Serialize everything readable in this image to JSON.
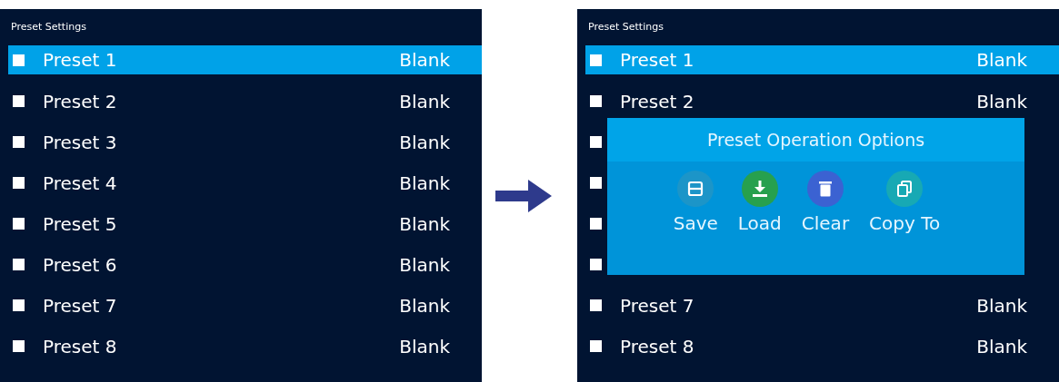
{
  "panels": [
    {
      "title": "Preset Settings",
      "rows": [
        {
          "label": "Preset 1",
          "value": "Blank",
          "selected": true,
          "checked": false
        },
        {
          "label": "Preset 2",
          "value": "Blank",
          "selected": false,
          "checked": false
        },
        {
          "label": "Preset 3",
          "value": "Blank",
          "selected": false,
          "checked": false
        },
        {
          "label": "Preset 4",
          "value": "Blank",
          "selected": false,
          "checked": false
        },
        {
          "label": "Preset 5",
          "value": "Blank",
          "selected": false,
          "checked": false
        },
        {
          "label": "Preset 6",
          "value": "Blank",
          "selected": false,
          "checked": false
        },
        {
          "label": "Preset 7",
          "value": "Blank",
          "selected": false,
          "checked": false
        },
        {
          "label": "Preset 8",
          "value": "Blank",
          "selected": false,
          "checked": false
        }
      ]
    },
    {
      "title": "Preset Settings",
      "rows": [
        {
          "label": "Preset 1",
          "value": "Blank",
          "selected": true,
          "checked": false
        },
        {
          "label": "Preset 2",
          "value": "Blank",
          "selected": false,
          "checked": false
        },
        {
          "selected": false,
          "checked": false
        },
        {
          "selected": false,
          "checked": false
        },
        {
          "selected": false,
          "checked": false
        },
        {
          "selected": false,
          "checked": false
        },
        {
          "label": "Preset 7",
          "value": "Blank",
          "selected": false,
          "checked": false
        },
        {
          "label": "Preset 8",
          "value": "Blank",
          "selected": false,
          "checked": false
        }
      ],
      "dialog": {
        "title": "Preset Operation Options",
        "options": [
          {
            "kind": "save",
            "label": "Save"
          },
          {
            "kind": "load",
            "label": "Load"
          },
          {
            "kind": "clear",
            "label": "Clear"
          },
          {
            "kind": "copy",
            "label": "Copy To"
          }
        ]
      }
    }
  ]
}
